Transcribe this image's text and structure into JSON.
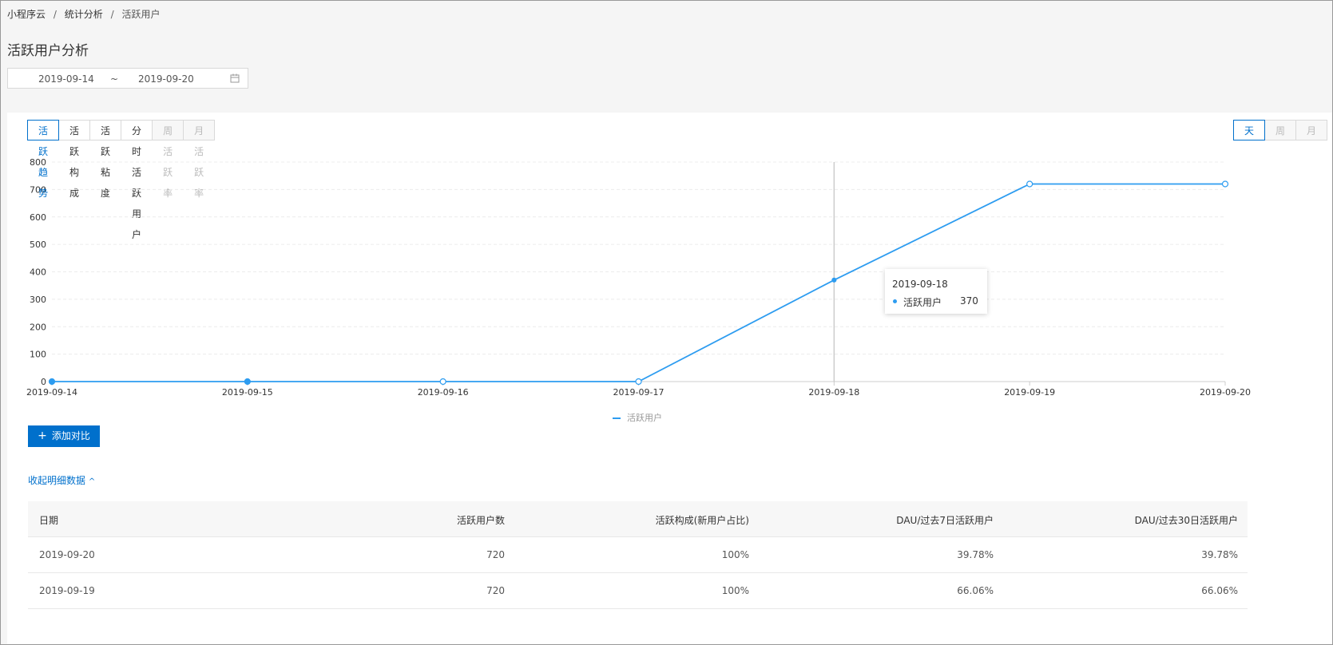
{
  "breadcrumb": [
    "小程序云",
    "统计分析",
    "活跃用户"
  ],
  "page_title": "活跃用户分析",
  "date_range": {
    "start": "2019-09-14",
    "separator": "~",
    "end": "2019-09-20"
  },
  "tabs": [
    {
      "label": "活跃趋势",
      "state": "active"
    },
    {
      "label": "活跃构成",
      "state": "normal"
    },
    {
      "label": "活跃粘度",
      "state": "normal"
    },
    {
      "label": "分时活跃用户",
      "state": "normal"
    },
    {
      "label": "周活跃率",
      "state": "disabled"
    },
    {
      "label": "月活跃率",
      "state": "disabled"
    }
  ],
  "period_tabs": [
    {
      "label": "天",
      "state": "active"
    },
    {
      "label": "周",
      "state": "disabled"
    },
    {
      "label": "月",
      "state": "disabled"
    }
  ],
  "chart_data": {
    "type": "line",
    "x": [
      "2019-09-14",
      "2019-09-15",
      "2019-09-16",
      "2019-09-17",
      "2019-09-18",
      "2019-09-19",
      "2019-09-20"
    ],
    "series": [
      {
        "name": "活跃用户",
        "values": [
          0,
          0,
          0,
          0,
          370,
          720,
          720
        ],
        "color": "#2d9cf0"
      }
    ],
    "ylim": [
      0,
      800
    ],
    "yticks": [
      0,
      100,
      200,
      300,
      400,
      500,
      600,
      700,
      800
    ],
    "grid": true,
    "legend": "bottom-center",
    "hover_index": 4
  },
  "tooltip": {
    "date": "2019-09-18",
    "series_name": "活跃用户",
    "value": "370"
  },
  "legend_label": "活跃用户",
  "add_compare_label": "添加对比",
  "collapse_label": "收起明细数据",
  "table": {
    "headers": [
      "日期",
      "活跃用户数",
      "活跃构成(新用户占比)",
      "DAU/过去7日活跃用户",
      "DAU/过去30日活跃用户"
    ],
    "rows": [
      [
        "2019-09-20",
        "720",
        "100%",
        "39.78%",
        "39.78%"
      ],
      [
        "2019-09-19",
        "720",
        "100%",
        "66.06%",
        "66.06%"
      ]
    ]
  }
}
